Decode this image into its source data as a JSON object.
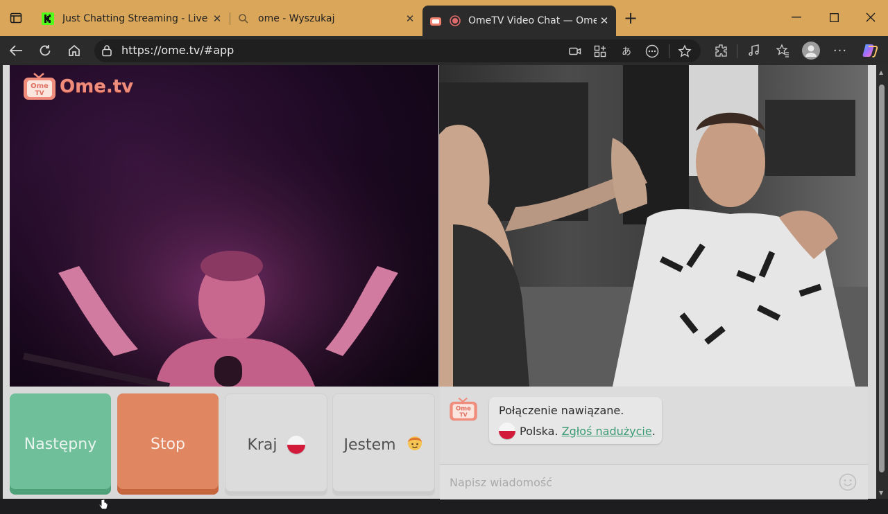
{
  "browser": {
    "tabs": [
      {
        "title": "Just Chatting Streaming - Live Str",
        "active": false
      },
      {
        "title": "ome - Wyszukaj",
        "active": false
      },
      {
        "title": "OmeTV Video Chat — Omeg",
        "active": true
      }
    ],
    "url": "https://ome.tv/#app"
  },
  "app": {
    "logo_text": "Ome.tv",
    "logo_badge": "Ome TV",
    "buttons": {
      "next": "Następny",
      "stop": "Stop",
      "country": "Kraj",
      "gender": "Jestem"
    },
    "chat": {
      "message_line1": "Połączenie nawiązane.",
      "country": "Polska.",
      "report_link": "Zgłoś nadużycie",
      "report_suffix": ".",
      "input_placeholder": "Napisz wiadomość"
    }
  },
  "colors": {
    "tabstrip": "#d9a65a",
    "next_button": "#6fc09a",
    "stop_button": "#e08661",
    "link": "#3a9a73",
    "logo": "#f08c7c"
  }
}
